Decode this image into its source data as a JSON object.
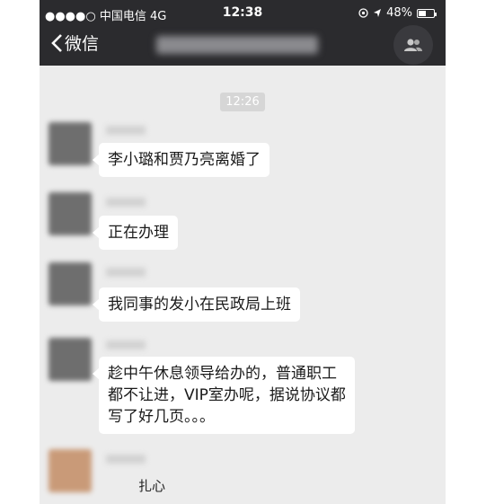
{
  "status_bar": {
    "carrier": "●●●●○ 中国电信  4G",
    "time": "12:38",
    "battery": "48%",
    "battery_level": 0.48
  },
  "nav": {
    "back_label": "微信",
    "back_icon": "chevron-left-icon",
    "people_icon": "group-icon"
  },
  "chat": {
    "timestamp": "12:26",
    "messages": [
      {
        "text": "李小璐和贾乃亮离婚了"
      },
      {
        "text": "正在办理"
      },
      {
        "text": "我同事的发小在民政局上班"
      },
      {
        "lines": [
          "趁中午休息领导给办的，普通职工",
          "都不让进，VIP室办呢，据说协议都",
          "写了好几页。。。"
        ]
      }
    ],
    "sticker_text": "扎心"
  },
  "colors": {
    "topbar": "#2b2b2e",
    "chat_bg": "#ececec",
    "bubble": "#ffffff"
  }
}
